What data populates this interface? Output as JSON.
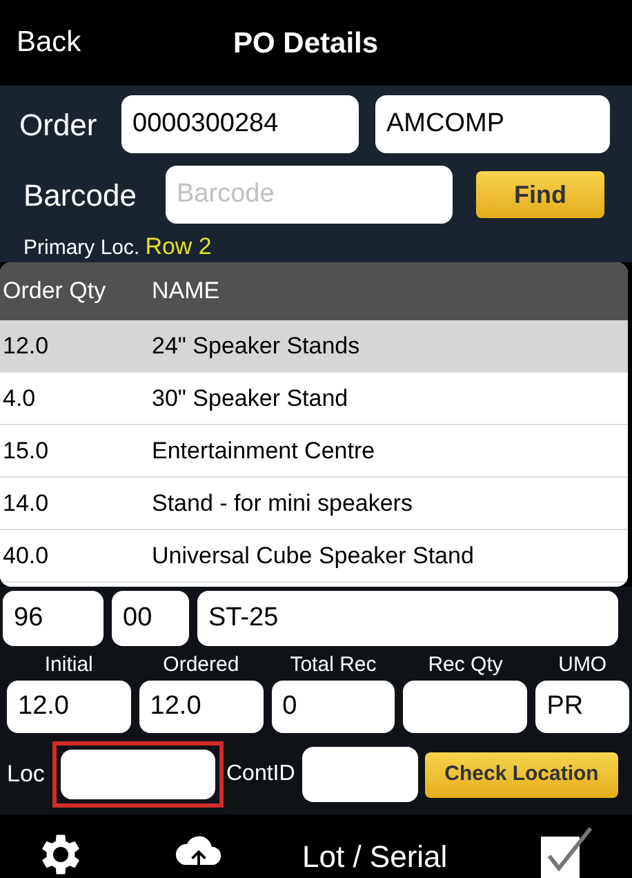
{
  "nav_bar": {
    "back": "Back",
    "title": "PO Details"
  },
  "form": {
    "order_label": "Order",
    "order_value": "0000300284",
    "vendor_value": "AMCOMP",
    "barcode_label": "Barcode",
    "barcode_placeholder": "Barcode",
    "find_button": "Find",
    "primary_loc_label": "Primary Loc.",
    "primary_loc_value": "Row 2"
  },
  "table": {
    "columns": [
      "Order Qty",
      "NAME"
    ],
    "rows": [
      {
        "qty": "12.0",
        "name": "24\" Speaker Stands",
        "selected": true
      },
      {
        "qty": "4.0",
        "name": "30\" Speaker Stand",
        "selected": false
      },
      {
        "qty": "15.0",
        "name": "Entertainment Centre",
        "selected": false
      },
      {
        "qty": "14.0",
        "name": "Stand - for mini speakers",
        "selected": false
      },
      {
        "qty": "40.0",
        "name": "Universal Cube Speaker Stand",
        "selected": false
      }
    ]
  },
  "item": {
    "line": "96",
    "sub": "00",
    "code": "ST-25"
  },
  "quantities": [
    {
      "label": "Initial",
      "value": "12.0"
    },
    {
      "label": "Ordered",
      "value": "12.0"
    },
    {
      "label": "Total Rec",
      "value": "0"
    },
    {
      "label": "Rec Qty"
    },
    {
      "label": "UMO",
      "value": "PR"
    }
  ],
  "location": {
    "loc_label": "Loc",
    "loc_highlighted": true,
    "contid_label": "ContID",
    "check_button": "Check Location"
  },
  "toolbar": {
    "lot_serial": "Lot / Serial"
  }
}
